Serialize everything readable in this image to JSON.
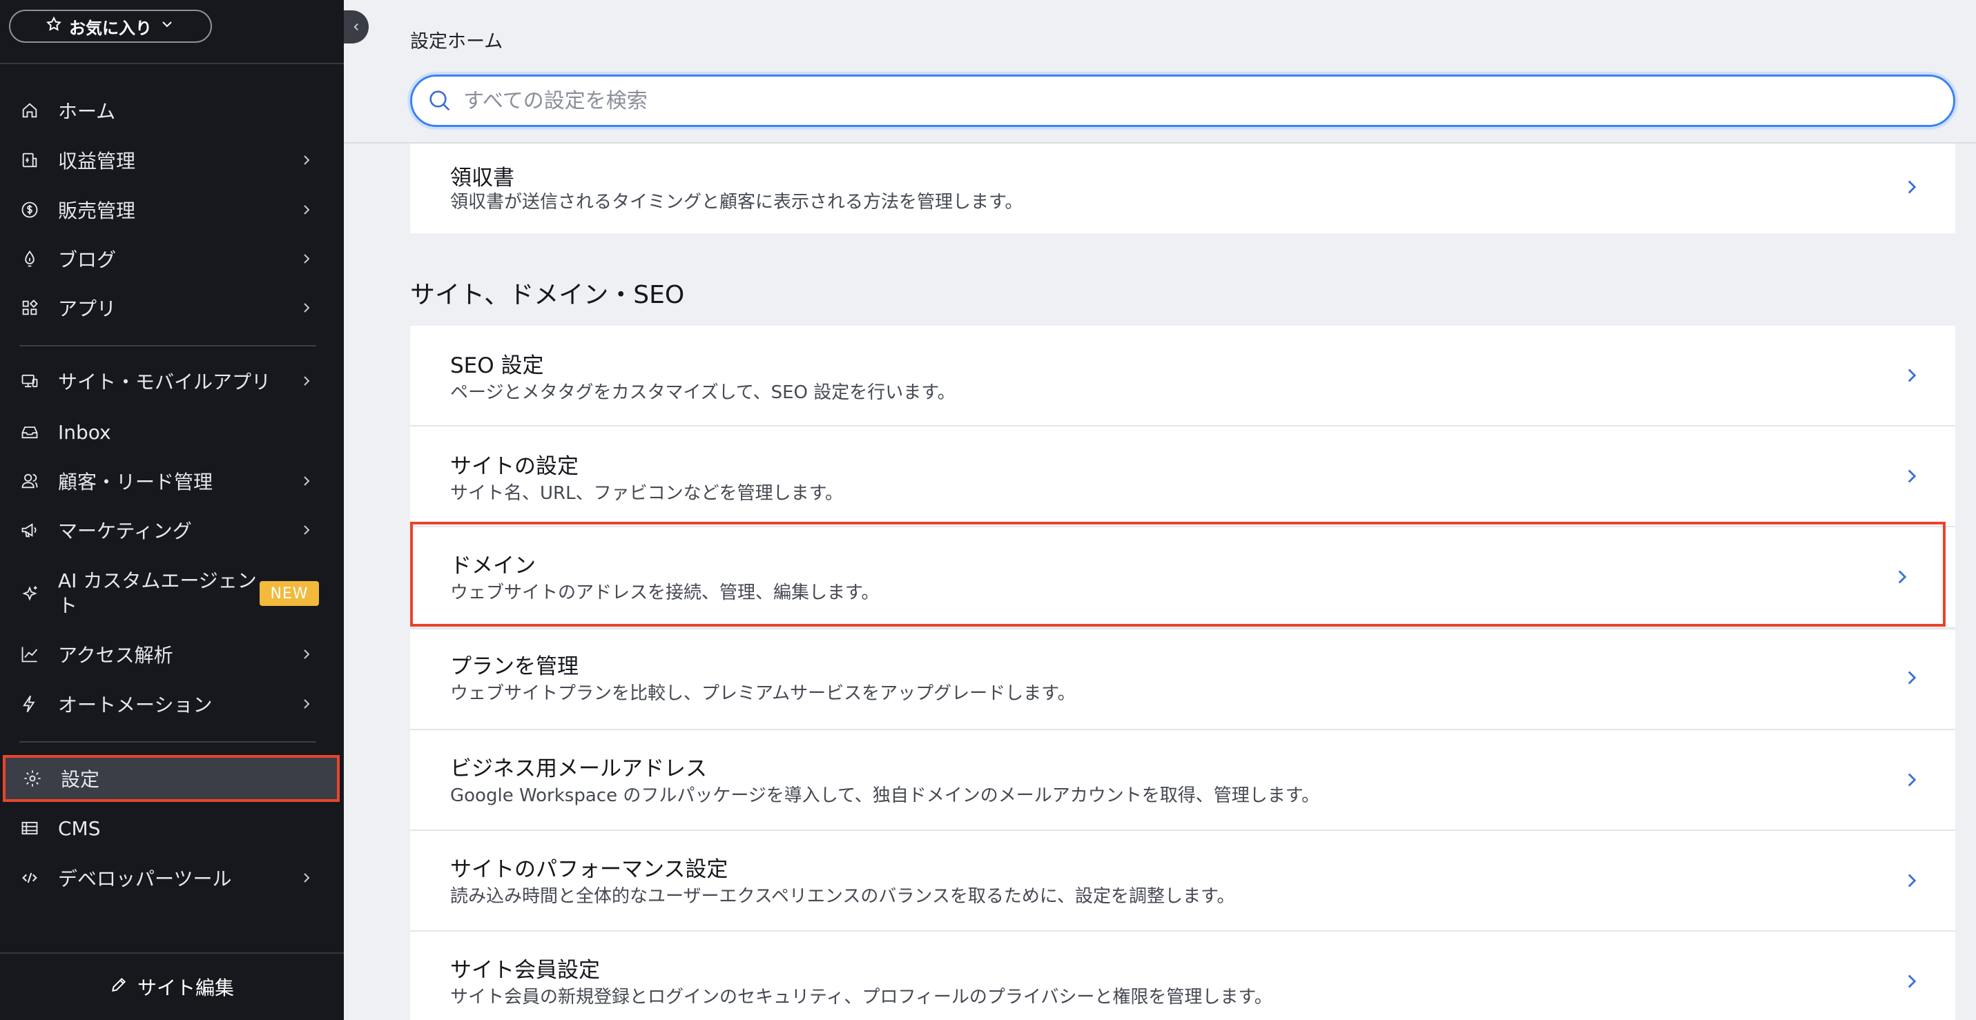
{
  "sidebar": {
    "favorites_label": "お気に入り",
    "items": [
      {
        "label": "ホーム",
        "icon": "home-icon"
      },
      {
        "label": "収益管理",
        "icon": "revenue-icon"
      },
      {
        "label": "販売管理",
        "icon": "dollar-circle-icon"
      },
      {
        "label": "ブログ",
        "icon": "pen-nib-icon"
      },
      {
        "label": "アプリ",
        "icon": "apps-icon"
      },
      {
        "label": "サイト・モバイルアプリ",
        "icon": "devices-icon"
      },
      {
        "label": "Inbox",
        "icon": "inbox-icon"
      },
      {
        "label": "顧客・リード管理",
        "icon": "contacts-icon"
      },
      {
        "label": "マーケティング",
        "icon": "megaphone-icon"
      },
      {
        "label": "AI カスタムエージェント",
        "icon": "sparkle-icon",
        "badge": "NEW"
      },
      {
        "label": "アクセス解析",
        "icon": "chart-line-icon"
      },
      {
        "label": "オートメーション",
        "icon": "bolt-icon"
      },
      {
        "label": "設定",
        "icon": "gear-icon"
      },
      {
        "label": "CMS",
        "icon": "table-icon"
      },
      {
        "label": "デベロッパーツール",
        "icon": "code-icon"
      }
    ],
    "footer_label": "サイト編集"
  },
  "main": {
    "breadcrumb": "設定ホーム",
    "search_placeholder": "すべての設定を検索",
    "receipt": {
      "title": "領収書",
      "desc": "領収書が送信されるタイミングと顧客に表示される方法を管理します。"
    },
    "section_title": "サイト、ドメイン・SEO",
    "rows": [
      {
        "title": "SEO 設定",
        "desc": "ページとメタタグをカスタマイズして、SEO 設定を行います。"
      },
      {
        "title": "サイトの設定",
        "desc": "サイト名、URL、ファビコンなどを管理します。"
      },
      {
        "title": "ドメイン",
        "desc": "ウェブサイトのアドレスを接続、管理、編集します。"
      },
      {
        "title": "プランを管理",
        "desc": "ウェブサイトプランを比較し、プレミアムサービスをアップグレードします。"
      },
      {
        "title": "ビジネス用メールアドレス",
        "desc": "Google Workspace のフルパッケージを導入して、独自ドメインのメールアカウントを取得、管理します。"
      },
      {
        "title": "サイトのパフォーマンス設定",
        "desc": "読み込み時間と全体的なユーザーエクスペリエンスのバランスを取るために、設定を調整します。"
      },
      {
        "title": "サイト会員設定",
        "desc": "サイト会員の新規登録とログインのセキュリティ、プロフィールのプライバシーと権限を管理します。"
      }
    ]
  },
  "colors": {
    "sidebar_bg": "#16181d",
    "accent": "#3b82f6",
    "highlight": "#e8452c",
    "badge": "#f2b93b"
  }
}
